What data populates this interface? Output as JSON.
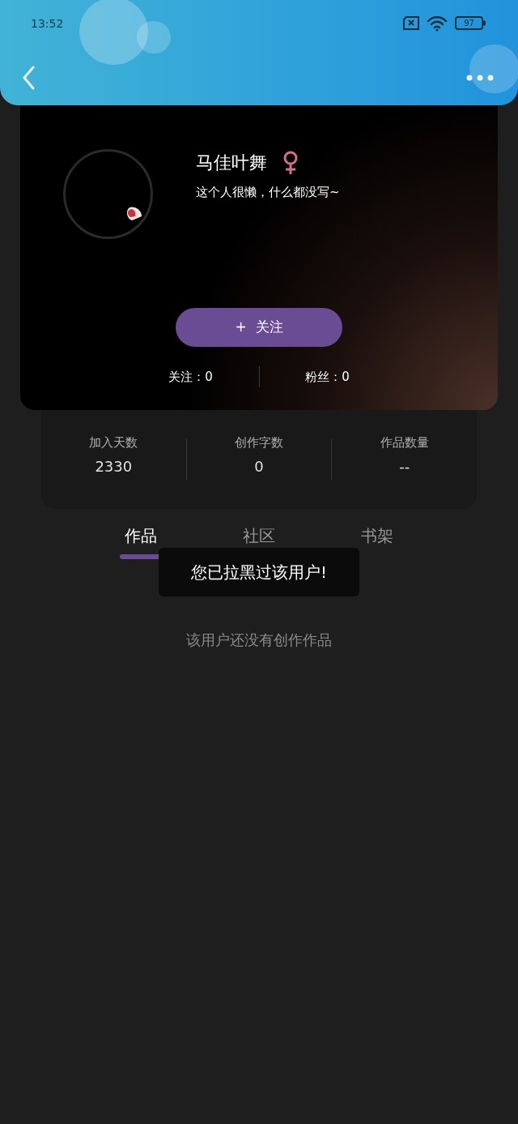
{
  "status_bar": {
    "time": "13:52",
    "battery": "97"
  },
  "profile": {
    "name": "马佳叶舞",
    "bio": "这个人很懒，什么都没写~",
    "follow_button": "+  关注",
    "following": "关注：0",
    "followers": "粉丝：0"
  },
  "stats": [
    {
      "label": "加入天数",
      "value": "2330"
    },
    {
      "label": "创作字数",
      "value": "0"
    },
    {
      "label": "作品数量",
      "value": "--"
    }
  ],
  "tabs": [
    {
      "label": "作品",
      "selected": true
    },
    {
      "label": "社区",
      "selected": false
    },
    {
      "label": "书架",
      "selected": false
    }
  ],
  "toast": "您已拉黑过该用户!",
  "empty_message": "该用户还没有创作作品"
}
